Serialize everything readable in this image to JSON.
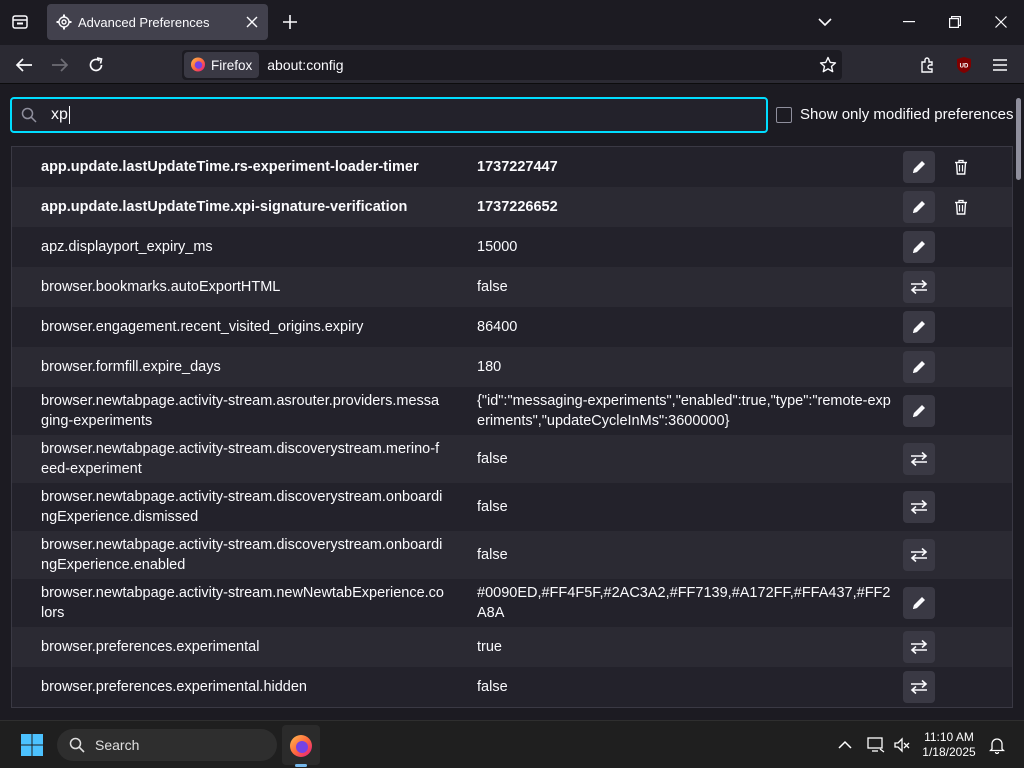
{
  "tabstrip": {
    "tab_title": "Advanced Preferences"
  },
  "navbar": {
    "identity_label": "Firefox",
    "url": "about:config",
    "extension_badge": "UD"
  },
  "search": {
    "value": "xp",
    "modified_label": "Show only modified preferences",
    "modified_checked": false
  },
  "prefs": [
    {
      "name": "app.update.lastUpdateTime.rs-experiment-loader-timer",
      "value": "1737227447",
      "action": "edit",
      "modified": true
    },
    {
      "name": "app.update.lastUpdateTime.xpi-signature-verification",
      "value": "1737226652",
      "action": "edit",
      "modified": true
    },
    {
      "name": "apz.displayport_expiry_ms",
      "value": "15000",
      "action": "edit",
      "modified": false
    },
    {
      "name": "browser.bookmarks.autoExportHTML",
      "value": "false",
      "action": "toggle",
      "modified": false
    },
    {
      "name": "browser.engagement.recent_visited_origins.expiry",
      "value": "86400",
      "action": "edit",
      "modified": false
    },
    {
      "name": "browser.formfill.expire_days",
      "value": "180",
      "action": "edit",
      "modified": false
    },
    {
      "name": "browser.newtabpage.activity-stream.asrouter.providers.messaging-experiments",
      "value": "{\"id\":\"messaging-experiments\",\"enabled\":true,\"type\":\"remote-experiments\",\"updateCycleInMs\":3600000}",
      "action": "edit",
      "modified": false
    },
    {
      "name": "browser.newtabpage.activity-stream.discoverystream.merino-feed-experiment",
      "value": "false",
      "action": "toggle",
      "modified": false
    },
    {
      "name": "browser.newtabpage.activity-stream.discoverystream.onboardingExperience.dismissed",
      "value": "false",
      "action": "toggle",
      "modified": false
    },
    {
      "name": "browser.newtabpage.activity-stream.discoverystream.onboardingExperience.enabled",
      "value": "false",
      "action": "toggle",
      "modified": false
    },
    {
      "name": "browser.newtabpage.activity-stream.newNewtabExperience.colors",
      "value": "#0090ED,#FF4F5F,#2AC3A2,#FF7139,#A172FF,#FFA437,#FF2A8A",
      "action": "edit",
      "modified": false
    },
    {
      "name": "browser.preferences.experimental",
      "value": "true",
      "action": "toggle",
      "modified": false
    },
    {
      "name": "browser.preferences.experimental.hidden",
      "value": "false",
      "action": "toggle",
      "modified": false
    }
  ],
  "taskbar": {
    "search_label": "Search",
    "time": "11:10 AM",
    "date": "1/18/2025"
  },
  "colors": {
    "focus_ring": "#00ddff",
    "row_odd": "#23222b",
    "row_even": "#2b2a33",
    "button": "#3a3944"
  }
}
